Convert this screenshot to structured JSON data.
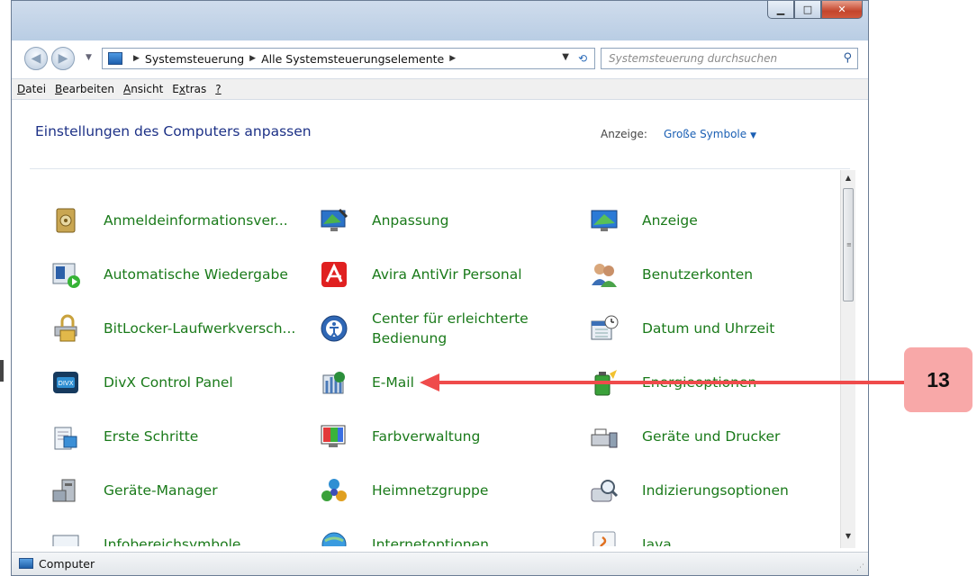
{
  "window": {
    "breadcrumb": [
      "Systemsteuerung",
      "Alle Systemsteuerungselemente"
    ],
    "search_placeholder": "Systemsteuerung durchsuchen"
  },
  "menu": [
    {
      "label": "Datei"
    },
    {
      "label": "Bearbeiten"
    },
    {
      "label": "Ansicht"
    },
    {
      "label": "Extras"
    },
    {
      "label": "?"
    }
  ],
  "content": {
    "title": "Einstellungen des Computers anpassen",
    "view_label": "Anzeige:",
    "view_value": "Große Symbole"
  },
  "items": [
    {
      "label": "Anmeldeinformationsver...",
      "icon": "credential-vault-icon"
    },
    {
      "label": "Anpassung",
      "icon": "personalization-icon"
    },
    {
      "label": "Anzeige",
      "icon": "display-icon"
    },
    {
      "label": "Automatische Wiedergabe",
      "icon": "autoplay-icon"
    },
    {
      "label": "Avira AntiVir Personal",
      "icon": "avira-icon"
    },
    {
      "label": "Benutzerkonten",
      "icon": "user-accounts-icon"
    },
    {
      "label": "BitLocker-Laufwerkversch...",
      "icon": "bitlocker-icon"
    },
    {
      "label": "Center für erleichterte\nBedienung",
      "icon": "ease-of-access-icon"
    },
    {
      "label": "Datum und Uhrzeit",
      "icon": "date-time-icon"
    },
    {
      "label": "DivX Control Panel",
      "icon": "divx-icon"
    },
    {
      "label": "E-Mail",
      "icon": "mail-icon"
    },
    {
      "label": "Energieoptionen",
      "icon": "power-options-icon"
    },
    {
      "label": "Erste Schritte",
      "icon": "getting-started-icon"
    },
    {
      "label": "Farbverwaltung",
      "icon": "color-management-icon"
    },
    {
      "label": "Geräte und Drucker",
      "icon": "devices-printers-icon"
    },
    {
      "label": "Geräte-Manager",
      "icon": "device-manager-icon"
    },
    {
      "label": "Heimnetzgruppe",
      "icon": "homegroup-icon"
    },
    {
      "label": "Indizierungsoptionen",
      "icon": "indexing-icon"
    },
    {
      "label": "Infobereichsymbole",
      "icon": "notification-area-icon"
    },
    {
      "label": "Internetoptionen",
      "icon": "internet-options-icon"
    },
    {
      "label": "Java",
      "icon": "java-icon"
    }
  ],
  "status": {
    "text": "Computer"
  },
  "annotation": {
    "number": "13",
    "color": "#ef4b4b",
    "badge_color": "#f8a8a8"
  },
  "colors": {
    "link_green": "#1a7a1a",
    "title_blue": "#1e3287",
    "accent_blue": "#1a5fb4"
  }
}
